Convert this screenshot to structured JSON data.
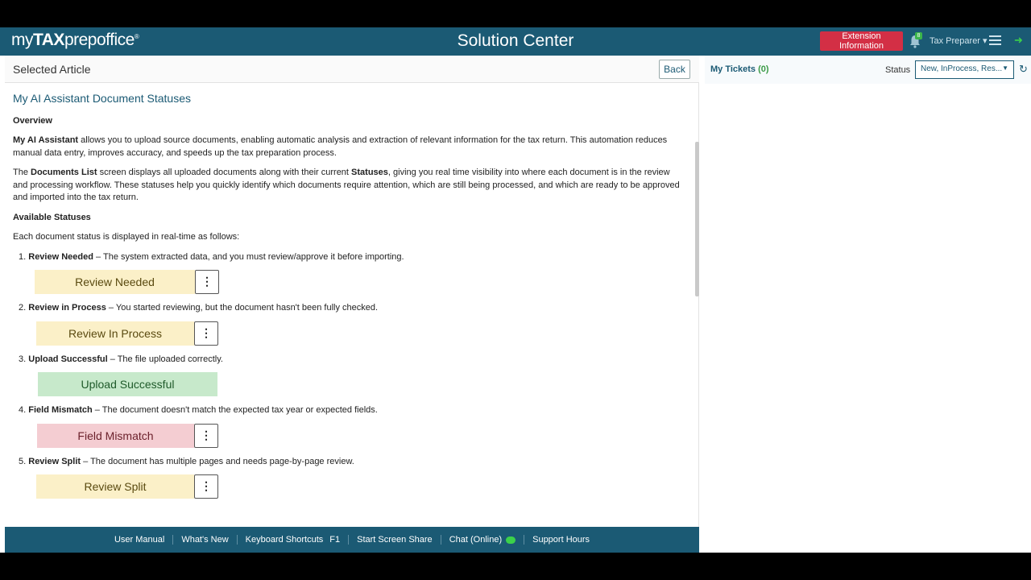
{
  "header": {
    "logo_prefix": "my",
    "logo_bold": "TAX",
    "logo_suffix": "prepoffice",
    "logo_mark": "®",
    "title": "Solution Center",
    "extension_button": "Extension Information",
    "notification_count": "8",
    "user_menu": "Tax Preparer ▾"
  },
  "left_panel": {
    "title": "Selected Article",
    "back_label": "Back"
  },
  "article": {
    "title": "My AI Assistant Document Statuses",
    "overview_heading": "Overview",
    "p1_bold": "My AI Assistant",
    "p1_text": " allows you to upload source documents, enabling automatic analysis and extraction of relevant information for the tax return. This automation reduces manual data entry, improves accuracy, and speeds up the tax preparation process.",
    "p2_a": "The ",
    "p2_bold1": "Documents List",
    "p2_b": " screen displays all uploaded documents along with their current ",
    "p2_bold2": "Statuses",
    "p2_c": ", giving you real time visibility into where each document is in the review and processing workflow. These statuses help you quickly identify which documents require attention, which are still being processed, and which are ready to be approved and imported into the tax return.",
    "statuses_heading": "Available Statuses",
    "statuses_intro": "Each document status is displayed in real-time as follows:",
    "items": [
      {
        "num": "1.",
        "name": "Review Needed",
        "desc": " – The system extracted data, and you must review/approve it before importing.",
        "pill": "Review Needed",
        "color": "#fbf0c8",
        "text_color": "#5a4a10"
      },
      {
        "num": "2.",
        "name": "Review in Process",
        "desc": " – You started reviewing, but the document hasn't been fully checked.",
        "pill": "Review In Process",
        "color": "#fbf0c8",
        "text_color": "#5a4a10"
      },
      {
        "num": "3.",
        "name": "Upload Successful",
        "desc": " – The file uploaded correctly.",
        "pill": "Upload Successful",
        "color": "#c7e9cb",
        "text_color": "#1f5a2a"
      },
      {
        "num": "4.",
        "name": "Field Mismatch",
        "desc": " – The document doesn't match the expected tax year or expected fields.",
        "pill": "Field Mismatch",
        "color": "#f4cdd2",
        "text_color": "#6a1f2a"
      },
      {
        "num": "5.",
        "name": "Review Split",
        "desc": " – The document has multiple pages and needs page-by-page review.",
        "pill": "Review Split",
        "color": "#fbf0c8",
        "text_color": "#5a4a10"
      }
    ]
  },
  "footer": {
    "links": [
      "User Manual",
      "What's New",
      "Keyboard Shortcuts",
      "Start Screen Share",
      "Chat (Online)",
      "Support Hours"
    ],
    "shortcut_key": "F1"
  },
  "right_panel": {
    "tickets_label": "My Tickets",
    "tickets_count": "(0)",
    "status_label": "Status",
    "status_value": "New, InProcess, Res..."
  },
  "icons": {
    "bell": "bell-icon",
    "menu": "hamburger-icon",
    "exit": "exit-icon",
    "kebab": "kebab-menu-icon",
    "refresh": "refresh-icon",
    "chat": "chat-bubble-icon"
  },
  "colors": {
    "header_bg": "#1b5a74",
    "extension_button": "#d32f45",
    "online_green": "#3bd14a"
  }
}
